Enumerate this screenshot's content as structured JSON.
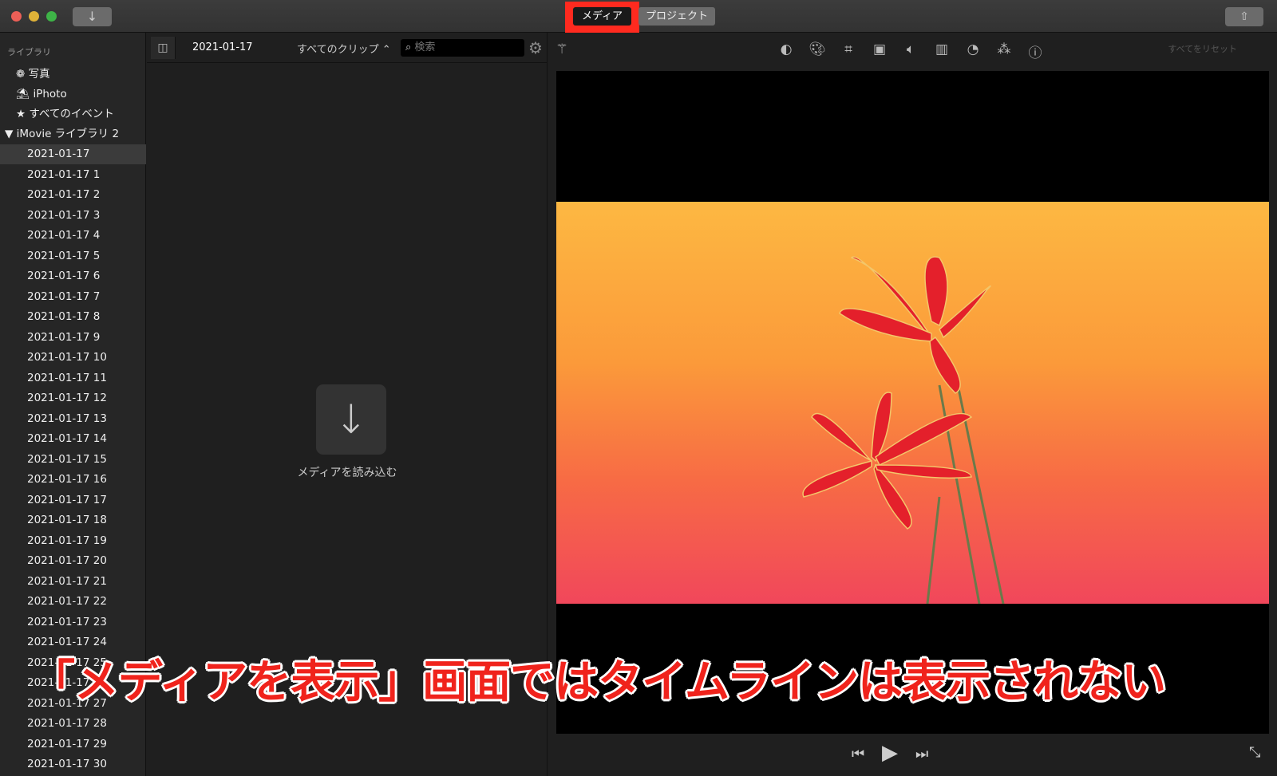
{
  "toolbar": {
    "media_tab": "メディア",
    "projects_tab": "プロジェクト",
    "import_icon": "arrow-down-icon",
    "share_icon": "share-icon",
    "highlight_color": "#ff2a1f"
  },
  "sidebar": {
    "header": "ライブラリ",
    "items": [
      {
        "icon": "photos-icon",
        "label": "写真"
      },
      {
        "icon": "palm-tree-icon",
        "label": "iPhoto"
      },
      {
        "icon": "star-icon",
        "label": "すべてのイベント"
      }
    ],
    "library": "▼ iMovie ライブラリ 2",
    "events": [
      "2021-01-17",
      "2021-01-17 1",
      "2021-01-17 2",
      "2021-01-17 3",
      "2021-01-17 4",
      "2021-01-17 5",
      "2021-01-17 6",
      "2021-01-17 7",
      "2021-01-17 8",
      "2021-01-17 9",
      "2021-01-17 10",
      "2021-01-17 11",
      "2021-01-17 12",
      "2021-01-17 13",
      "2021-01-17 14",
      "2021-01-17 15",
      "2021-01-17 16",
      "2021-01-17 17",
      "2021-01-17 18",
      "2021-01-17 19",
      "2021-01-17 20",
      "2021-01-17 21",
      "2021-01-17 22",
      "2021-01-17 23",
      "2021-01-17 24",
      "2021-01-17 25",
      "2021-01-17 26",
      "2021-01-17 27",
      "2021-01-17 28",
      "2021-01-17 29",
      "2021-01-17 30"
    ],
    "selected": "2021-01-17"
  },
  "browser": {
    "title": "2021-01-17",
    "filter": "すべてのクリップ ⌃",
    "search_placeholder": "検索",
    "import_label": "メディアを読み込む"
  },
  "viewer": {
    "reset_label": "すべてをリセット",
    "tools": [
      "color-balance-icon",
      "color-correction-icon",
      "crop-icon",
      "stabilization-icon",
      "volume-icon",
      "noise-reduction-icon",
      "speed-icon",
      "clip-filter-icon",
      "info-icon"
    ]
  },
  "caption": "「メディアを表示」画面ではタイムラインは表示されない"
}
